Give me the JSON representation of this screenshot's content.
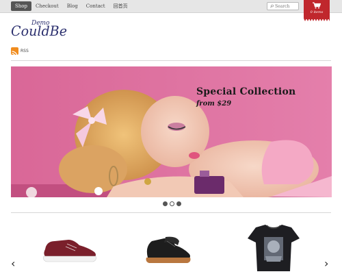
{
  "nav": {
    "items": [
      {
        "label": "Shop",
        "active": true
      },
      {
        "label": "Checkout",
        "active": false
      },
      {
        "label": "Blog",
        "active": false
      },
      {
        "label": "Contact",
        "active": false
      },
      {
        "label": "回首页",
        "active": false
      }
    ]
  },
  "search": {
    "placeholder": "Search"
  },
  "cart": {
    "count_label": "0 items"
  },
  "logo": {
    "small": "Demo",
    "main": "CouldBe"
  },
  "rss": {
    "label": "RSS"
  },
  "hero": {
    "title": "Special Collection",
    "subtitle": "from $29",
    "slides": 3,
    "active_slide": 1
  },
  "colors": {
    "accent": "#c0272d",
    "hero_bg": "#d96b9a",
    "logo": "#2b2f6e"
  },
  "icons": {
    "search": "search-icon",
    "cart": "cart-icon",
    "rss": "rss-icon",
    "prev": "chevron-left-icon",
    "next": "chevron-right-icon"
  },
  "products": [
    {
      "name": "burgundy-sneaker"
    },
    {
      "name": "black-chukka-boot"
    },
    {
      "name": "graphic-tshirt"
    }
  ],
  "carousel": {
    "prev": "‹",
    "next": "›"
  }
}
